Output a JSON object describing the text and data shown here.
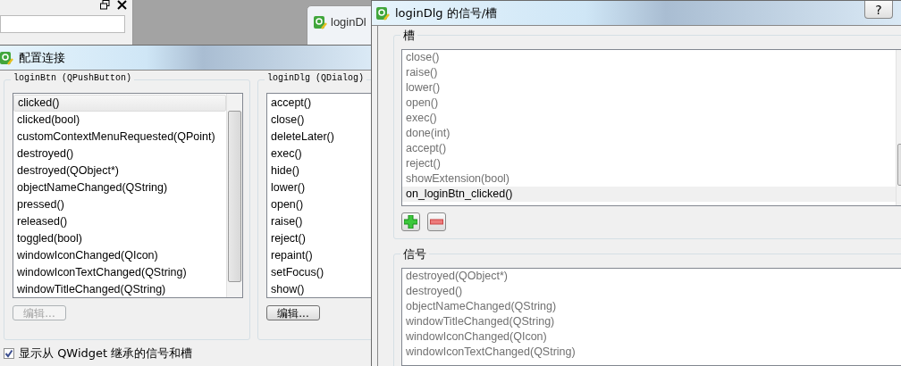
{
  "designer_tab": {
    "title": "loginDl"
  },
  "connect_dialog": {
    "title": "配置连接",
    "sender": {
      "title": "loginBtn (QPushButton)",
      "edit_button": {
        "label": "编辑...",
        "disabled": true
      },
      "items": [
        {
          "label": "clicked()",
          "selected": true
        },
        {
          "label": "clicked(bool)",
          "selected": false
        },
        {
          "label": "customContextMenuRequested(QPoint)",
          "selected": false
        },
        {
          "label": "destroyed()",
          "selected": false
        },
        {
          "label": "destroyed(QObject*)",
          "selected": false
        },
        {
          "label": "objectNameChanged(QString)",
          "selected": false
        },
        {
          "label": "pressed()",
          "selected": false
        },
        {
          "label": "released()",
          "selected": false
        },
        {
          "label": "toggled(bool)",
          "selected": false
        },
        {
          "label": "windowIconChanged(QIcon)",
          "selected": false
        },
        {
          "label": "windowIconTextChanged(QString)",
          "selected": false
        },
        {
          "label": "windowTitleChanged(QString)",
          "selected": false
        }
      ]
    },
    "receiver": {
      "title": "loginDlg (QDialog)",
      "edit_button": {
        "label": "编辑...",
        "disabled": false
      },
      "items": [
        {
          "label": "accept()",
          "selected": false
        },
        {
          "label": "close()",
          "selected": false
        },
        {
          "label": "deleteLater()",
          "selected": false
        },
        {
          "label": "exec()",
          "selected": false
        },
        {
          "label": "hide()",
          "selected": false
        },
        {
          "label": "lower()",
          "selected": false
        },
        {
          "label": "open()",
          "selected": false
        },
        {
          "label": "raise()",
          "selected": false
        },
        {
          "label": "reject()",
          "selected": false
        },
        {
          "label": "repaint()",
          "selected": false
        },
        {
          "label": "setFocus()",
          "selected": false
        },
        {
          "label": "show()",
          "selected": false
        }
      ]
    },
    "show_inherited": {
      "label": "显示从 QWidget 继承的信号和槽",
      "checked": true
    }
  },
  "slots_dialog": {
    "title": "loginDlg 的信号/槽",
    "help_button": "?",
    "slots": {
      "title": "槽",
      "items": [
        {
          "label": "close()",
          "inherited": true,
          "selected": false
        },
        {
          "label": "raise()",
          "inherited": true,
          "selected": false
        },
        {
          "label": "lower()",
          "inherited": true,
          "selected": false
        },
        {
          "label": "open()",
          "inherited": true,
          "selected": false
        },
        {
          "label": "exec()",
          "inherited": true,
          "selected": false
        },
        {
          "label": "done(int)",
          "inherited": true,
          "selected": false
        },
        {
          "label": "accept()",
          "inherited": true,
          "selected": false
        },
        {
          "label": "reject()",
          "inherited": true,
          "selected": false
        },
        {
          "label": "showExtension(bool)",
          "inherited": true,
          "selected": false
        },
        {
          "label": "on_loginBtn_clicked()",
          "inherited": false,
          "selected": true
        }
      ]
    },
    "signals": {
      "title": "信号",
      "items": [
        {
          "label": "destroyed(QObject*)",
          "inherited": true,
          "selected": false
        },
        {
          "label": "destroyed()",
          "inherited": true,
          "selected": false
        },
        {
          "label": "objectNameChanged(QString)",
          "inherited": true,
          "selected": false
        },
        {
          "label": "windowTitleChanged(QString)",
          "inherited": true,
          "selected": false
        },
        {
          "label": "windowIconChanged(QIcon)",
          "inherited": true,
          "selected": false
        },
        {
          "label": "windowIconTextChanged(QString)",
          "inherited": true,
          "selected": false
        }
      ]
    }
  }
}
